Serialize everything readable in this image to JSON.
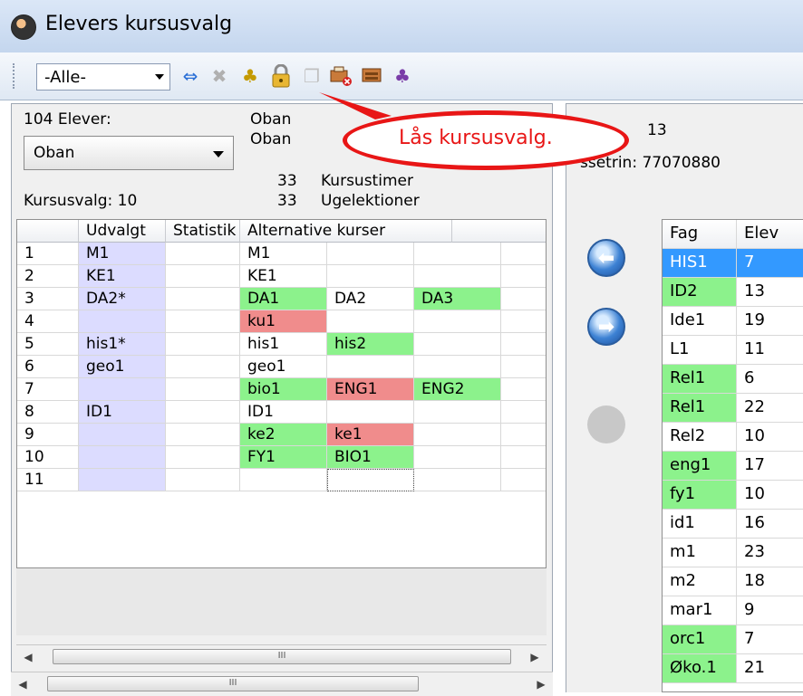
{
  "window": {
    "title": "Elevers kursusvalg"
  },
  "toolbar": {
    "filter_value": "-Alle-",
    "icons": [
      "swap-arrows-icon",
      "delete-x-icon",
      "group-people-icon",
      "lock-icon",
      "copy-windows-icon",
      "remove-print-icon",
      "print-stack-icon",
      "users-icon"
    ]
  },
  "student_panel": {
    "count_label": "104 Elever:",
    "selected_student": "Oban",
    "name_line1": "Oban",
    "name_line2": "Oban",
    "course_choice_label": "Kursusvalg: 10",
    "course_hours_value": "33",
    "course_hours_label": "Kursustimer",
    "week_lessons_value": "33",
    "week_lessons_label": "Ugelektioner"
  },
  "grid": {
    "headers": {
      "udvalgt": "Udvalgt",
      "statistik": "Statistik",
      "alternative": "Alternative kurser"
    },
    "rows": [
      {
        "n": "1",
        "udvalgt": "M1",
        "alts": [
          "M1",
          "",
          "",
          ""
        ]
      },
      {
        "n": "2",
        "udvalgt": "KE1",
        "alts": [
          "KE1",
          "",
          "",
          ""
        ]
      },
      {
        "n": "3",
        "udvalgt": "DA2*",
        "alts": [
          "DA1",
          "DA2",
          "DA3",
          ""
        ]
      },
      {
        "n": "4",
        "udvalgt": "",
        "alts": [
          "ku1",
          "",
          "",
          ""
        ]
      },
      {
        "n": "5",
        "udvalgt": "his1*",
        "alts": [
          "his1",
          "his2",
          "",
          ""
        ]
      },
      {
        "n": "6",
        "udvalgt": "geo1",
        "alts": [
          "geo1",
          "",
          "",
          ""
        ]
      },
      {
        "n": "7",
        "udvalgt": "",
        "alts": [
          "bio1",
          "ENG1",
          "ENG2",
          ""
        ]
      },
      {
        "n": "8",
        "udvalgt": "ID1",
        "alts": [
          "ID1",
          "",
          "",
          ""
        ]
      },
      {
        "n": "9",
        "udvalgt": "",
        "alts": [
          "ke2",
          "ke1",
          "",
          ""
        ]
      },
      {
        "n": "10",
        "udvalgt": "",
        "alts": [
          "FY1",
          "BIO1",
          "",
          ""
        ]
      },
      {
        "n": "11",
        "udvalgt": "",
        "alts": [
          "",
          "",
          "",
          ""
        ]
      }
    ],
    "cell_colors": {
      "green": "#8cf28c",
      "red": "#f08c8c",
      "selected_column": "#dcdcff"
    }
  },
  "scroll": {
    "thumb_label": "III"
  },
  "right_panel": {
    "partial_value": "13",
    "class_level_label": "ssetrin: 77070880",
    "headers": {
      "fag": "Fag",
      "elev": "Elev"
    },
    "rows": [
      {
        "fag": "HIS1",
        "elev": "7",
        "state": "selected"
      },
      {
        "fag": "ID2",
        "elev": "13",
        "state": "green"
      },
      {
        "fag": "Ide1",
        "elev": "19",
        "state": "plain"
      },
      {
        "fag": "L1",
        "elev": "11",
        "state": "plain"
      },
      {
        "fag": "Rel1",
        "elev": "6",
        "state": "green"
      },
      {
        "fag": "Rel1",
        "elev": "22",
        "state": "green"
      },
      {
        "fag": "Rel2",
        "elev": "10",
        "state": "plain"
      },
      {
        "fag": "eng1",
        "elev": "17",
        "state": "green"
      },
      {
        "fag": "fy1",
        "elev": "10",
        "state": "green"
      },
      {
        "fag": "id1",
        "elev": "16",
        "state": "plain"
      },
      {
        "fag": "m1",
        "elev": "23",
        "state": "plain"
      },
      {
        "fag": "m2",
        "elev": "18",
        "state": "plain"
      },
      {
        "fag": "mar1",
        "elev": "9",
        "state": "plain"
      },
      {
        "fag": "orc1",
        "elev": "7",
        "state": "green"
      },
      {
        "fag": "Øko.1",
        "elev": "21",
        "state": "green"
      }
    ]
  },
  "callout": {
    "text": "Lås kursusvalg.",
    "color": "#e81616"
  }
}
